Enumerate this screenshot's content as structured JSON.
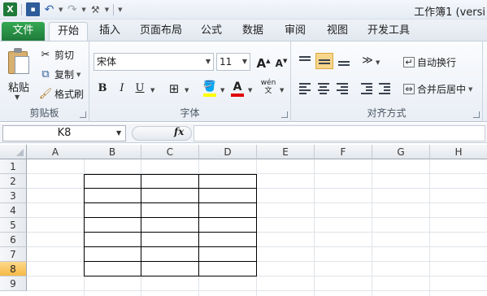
{
  "window": {
    "title": "工作簿1 (versi"
  },
  "quick_access": {
    "icons": [
      "excel-icon",
      "save-icon",
      "undo-icon",
      "redo-icon",
      "customize-icon"
    ]
  },
  "tabs": [
    {
      "label": "文件"
    },
    {
      "label": "开始"
    },
    {
      "label": "插入"
    },
    {
      "label": "页面布局"
    },
    {
      "label": "公式"
    },
    {
      "label": "数据"
    },
    {
      "label": "审阅"
    },
    {
      "label": "视图"
    },
    {
      "label": "开发工具"
    }
  ],
  "ribbon": {
    "clipboard": {
      "paste": "粘贴",
      "cut": "剪切",
      "copy": "复制",
      "format_painter": "格式刷",
      "group": "剪贴板"
    },
    "font": {
      "name": "宋体",
      "size": "11",
      "bold": "B",
      "italic": "I",
      "underline": "U",
      "grow": "A",
      "shrink": "A",
      "group": "字体",
      "phonetic": "wén"
    },
    "alignment": {
      "wrap": "自动换行",
      "merge": "合并后居中",
      "group": "对齐方式"
    }
  },
  "formula_bar": {
    "name_box": "K8",
    "fx": "fx",
    "formula": ""
  },
  "sheet": {
    "columns": [
      "A",
      "B",
      "C",
      "D",
      "E",
      "F",
      "G",
      "H"
    ],
    "rows": [
      "1",
      "2",
      "3",
      "4",
      "5",
      "6",
      "7",
      "8",
      "9"
    ],
    "selected_row": "8",
    "selected_cell": "K8"
  }
}
